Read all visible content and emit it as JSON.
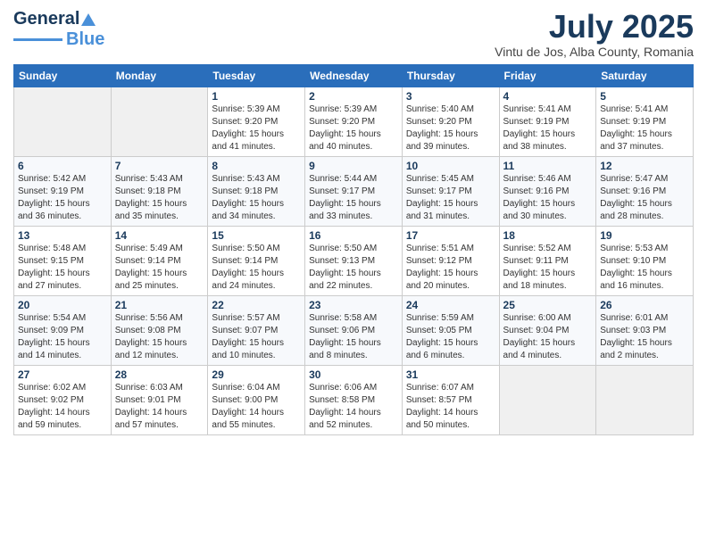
{
  "logo": {
    "line1": "General",
    "line2": "Blue"
  },
  "title": "July 2025",
  "location": "Vintu de Jos, Alba County, Romania",
  "headers": [
    "Sunday",
    "Monday",
    "Tuesday",
    "Wednesday",
    "Thursday",
    "Friday",
    "Saturday"
  ],
  "weeks": [
    [
      {
        "day": "",
        "info": ""
      },
      {
        "day": "",
        "info": ""
      },
      {
        "day": "1",
        "info": "Sunrise: 5:39 AM\nSunset: 9:20 PM\nDaylight: 15 hours\nand 41 minutes."
      },
      {
        "day": "2",
        "info": "Sunrise: 5:39 AM\nSunset: 9:20 PM\nDaylight: 15 hours\nand 40 minutes."
      },
      {
        "day": "3",
        "info": "Sunrise: 5:40 AM\nSunset: 9:20 PM\nDaylight: 15 hours\nand 39 minutes."
      },
      {
        "day": "4",
        "info": "Sunrise: 5:41 AM\nSunset: 9:19 PM\nDaylight: 15 hours\nand 38 minutes."
      },
      {
        "day": "5",
        "info": "Sunrise: 5:41 AM\nSunset: 9:19 PM\nDaylight: 15 hours\nand 37 minutes."
      }
    ],
    [
      {
        "day": "6",
        "info": "Sunrise: 5:42 AM\nSunset: 9:19 PM\nDaylight: 15 hours\nand 36 minutes."
      },
      {
        "day": "7",
        "info": "Sunrise: 5:43 AM\nSunset: 9:18 PM\nDaylight: 15 hours\nand 35 minutes."
      },
      {
        "day": "8",
        "info": "Sunrise: 5:43 AM\nSunset: 9:18 PM\nDaylight: 15 hours\nand 34 minutes."
      },
      {
        "day": "9",
        "info": "Sunrise: 5:44 AM\nSunset: 9:17 PM\nDaylight: 15 hours\nand 33 minutes."
      },
      {
        "day": "10",
        "info": "Sunrise: 5:45 AM\nSunset: 9:17 PM\nDaylight: 15 hours\nand 31 minutes."
      },
      {
        "day": "11",
        "info": "Sunrise: 5:46 AM\nSunset: 9:16 PM\nDaylight: 15 hours\nand 30 minutes."
      },
      {
        "day": "12",
        "info": "Sunrise: 5:47 AM\nSunset: 9:16 PM\nDaylight: 15 hours\nand 28 minutes."
      }
    ],
    [
      {
        "day": "13",
        "info": "Sunrise: 5:48 AM\nSunset: 9:15 PM\nDaylight: 15 hours\nand 27 minutes."
      },
      {
        "day": "14",
        "info": "Sunrise: 5:49 AM\nSunset: 9:14 PM\nDaylight: 15 hours\nand 25 minutes."
      },
      {
        "day": "15",
        "info": "Sunrise: 5:50 AM\nSunset: 9:14 PM\nDaylight: 15 hours\nand 24 minutes."
      },
      {
        "day": "16",
        "info": "Sunrise: 5:50 AM\nSunset: 9:13 PM\nDaylight: 15 hours\nand 22 minutes."
      },
      {
        "day": "17",
        "info": "Sunrise: 5:51 AM\nSunset: 9:12 PM\nDaylight: 15 hours\nand 20 minutes."
      },
      {
        "day": "18",
        "info": "Sunrise: 5:52 AM\nSunset: 9:11 PM\nDaylight: 15 hours\nand 18 minutes."
      },
      {
        "day": "19",
        "info": "Sunrise: 5:53 AM\nSunset: 9:10 PM\nDaylight: 15 hours\nand 16 minutes."
      }
    ],
    [
      {
        "day": "20",
        "info": "Sunrise: 5:54 AM\nSunset: 9:09 PM\nDaylight: 15 hours\nand 14 minutes."
      },
      {
        "day": "21",
        "info": "Sunrise: 5:56 AM\nSunset: 9:08 PM\nDaylight: 15 hours\nand 12 minutes."
      },
      {
        "day": "22",
        "info": "Sunrise: 5:57 AM\nSunset: 9:07 PM\nDaylight: 15 hours\nand 10 minutes."
      },
      {
        "day": "23",
        "info": "Sunrise: 5:58 AM\nSunset: 9:06 PM\nDaylight: 15 hours\nand 8 minutes."
      },
      {
        "day": "24",
        "info": "Sunrise: 5:59 AM\nSunset: 9:05 PM\nDaylight: 15 hours\nand 6 minutes."
      },
      {
        "day": "25",
        "info": "Sunrise: 6:00 AM\nSunset: 9:04 PM\nDaylight: 15 hours\nand 4 minutes."
      },
      {
        "day": "26",
        "info": "Sunrise: 6:01 AM\nSunset: 9:03 PM\nDaylight: 15 hours\nand 2 minutes."
      }
    ],
    [
      {
        "day": "27",
        "info": "Sunrise: 6:02 AM\nSunset: 9:02 PM\nDaylight: 14 hours\nand 59 minutes."
      },
      {
        "day": "28",
        "info": "Sunrise: 6:03 AM\nSunset: 9:01 PM\nDaylight: 14 hours\nand 57 minutes."
      },
      {
        "day": "29",
        "info": "Sunrise: 6:04 AM\nSunset: 9:00 PM\nDaylight: 14 hours\nand 55 minutes."
      },
      {
        "day": "30",
        "info": "Sunrise: 6:06 AM\nSunset: 8:58 PM\nDaylight: 14 hours\nand 52 minutes."
      },
      {
        "day": "31",
        "info": "Sunrise: 6:07 AM\nSunset: 8:57 PM\nDaylight: 14 hours\nand 50 minutes."
      },
      {
        "day": "",
        "info": ""
      },
      {
        "day": "",
        "info": ""
      }
    ]
  ]
}
